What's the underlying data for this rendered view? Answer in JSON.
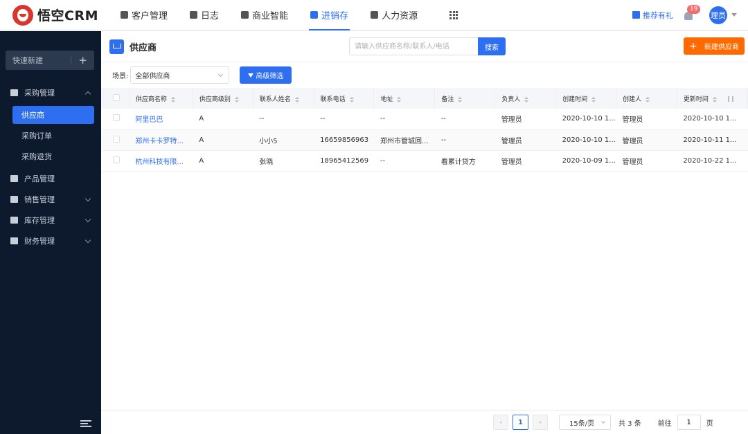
{
  "app": {
    "logo_text": "悟空CRM"
  },
  "nav": {
    "items": [
      {
        "label": "客户管理",
        "icon": "building-icon"
      },
      {
        "label": "日志",
        "icon": "journal-icon"
      },
      {
        "label": "商业智能",
        "icon": "shield-chart-icon"
      },
      {
        "label": "进销存",
        "icon": "inventory-icon",
        "active": true
      },
      {
        "label": "人力资源",
        "icon": "people-icon"
      }
    ],
    "apps_icon": "grid-apps-icon",
    "gift_label": "推荐有礼",
    "notification_count": "19",
    "avatar_text": "理员"
  },
  "sidebar": {
    "quick_new_label": "快速新建",
    "quick_new_plus": "+",
    "groups": [
      {
        "label": "采购管理",
        "icon": "cart-icon",
        "expanded": true,
        "children": [
          {
            "label": "供应商",
            "active": true
          },
          {
            "label": "采购订单"
          },
          {
            "label": "采购退货"
          }
        ]
      },
      {
        "label": "产品管理",
        "icon": "cube-icon"
      },
      {
        "label": "销售管理",
        "icon": "tag-icon"
      },
      {
        "label": "库存管理",
        "icon": "warehouse-icon"
      },
      {
        "label": "财务管理",
        "icon": "wallet-icon"
      }
    ]
  },
  "page": {
    "title": "供应商",
    "search_placeholder": "请输入供应商名称/联系人/电话",
    "search_button": "搜索",
    "new_button": "新建供应商",
    "new_button_plus": "+",
    "scene_label": "场景:",
    "scene_value": "全部供应商",
    "advanced_filter": "高级筛选"
  },
  "table": {
    "columns": [
      "供应商名称",
      "供应商级别",
      "联系人姓名",
      "联系电话",
      "地址",
      "备注",
      "负责人",
      "创建时间",
      "创建人",
      "更新时间"
    ],
    "rows": [
      [
        "阿里巴巴",
        "A",
        "--",
        "--",
        "--",
        "--",
        "管理员",
        "2020-10-10 1...",
        "管理员",
        "2020-10-10 1..."
      ],
      [
        "郑州卡卡罗特...",
        "A",
        "小小5",
        "16659856963",
        "郑州市管城回...",
        "--",
        "管理员",
        "2020-10-10 1...",
        "管理员",
        "2020-10-11 1..."
      ],
      [
        "杭州科技有限...",
        "A",
        "张晓",
        "18965412569",
        "--",
        "看累计贷方",
        "管理员",
        "2020-10-09 1...",
        "管理员",
        "2020-10-22 1..."
      ]
    ]
  },
  "pagination": {
    "prev": "‹",
    "next": "›",
    "current_page": "1",
    "page_size": "15条/页",
    "total": "共 3 条",
    "goto_prefix": "前往",
    "goto_value": "1",
    "goto_suffix": "页"
  },
  "colors": {
    "primary": "#2d6ff0",
    "accent_orange": "#ff6a00",
    "sidebar_bg": "#0d1a2e"
  }
}
